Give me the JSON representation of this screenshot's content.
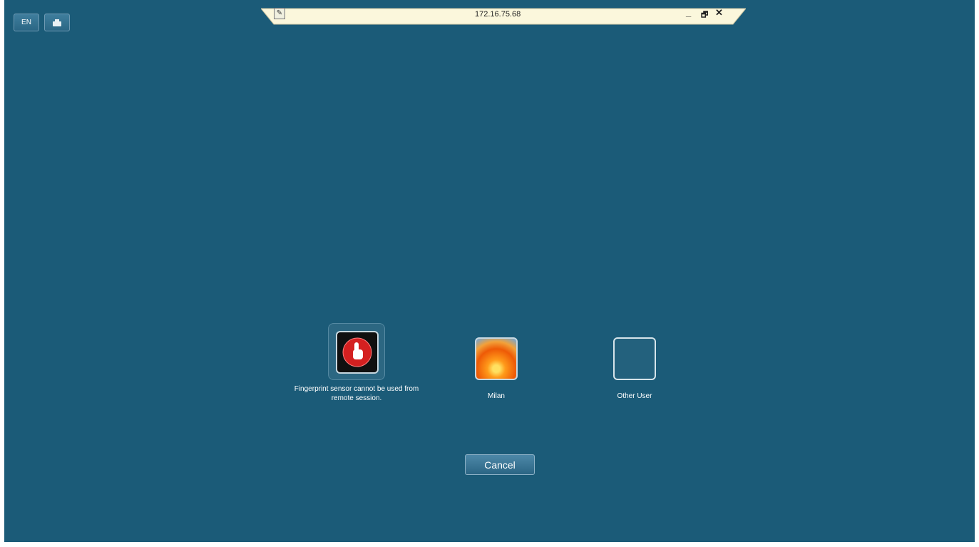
{
  "toolbar": {
    "language_label": "EN",
    "keyboard_icon": "keyboard-icon"
  },
  "connection_bar": {
    "host": "172.16.75.68",
    "pin_icon": "pin-icon",
    "minimize_label": "_",
    "restore_label": "🗗",
    "close_label": "✕"
  },
  "tiles": [
    {
      "label": "Fingerprint sensor cannot be used from remote session.",
      "icon": "fingerprint-icon"
    },
    {
      "label": "Milan",
      "icon": "user-picture-flower"
    },
    {
      "label": "Other User",
      "icon": "blank-user-picture"
    }
  ],
  "cancel_label": "Cancel",
  "colors": {
    "background": "#1b5b78",
    "bar": "#fbf7dc"
  }
}
